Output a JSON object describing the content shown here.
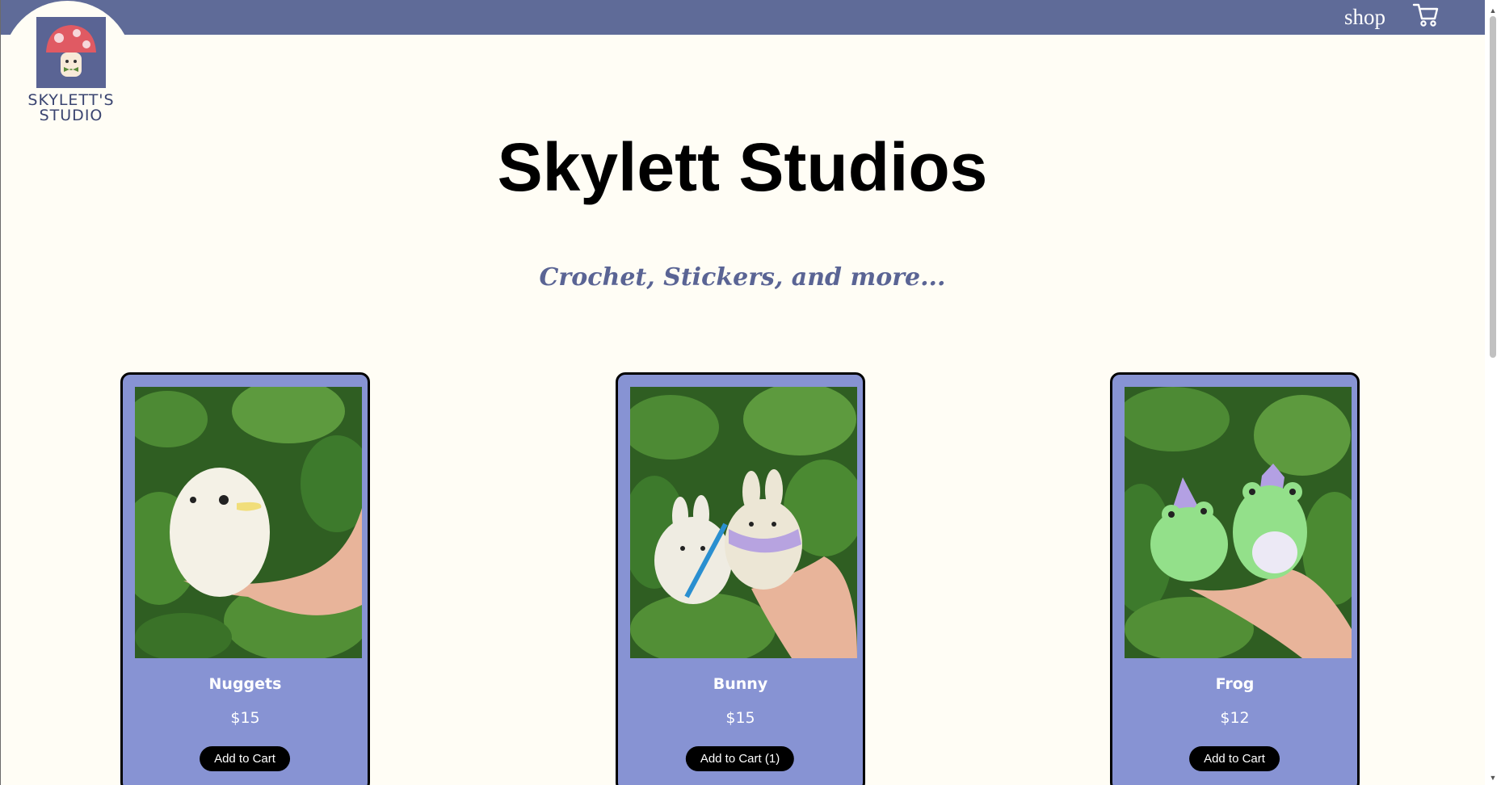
{
  "header": {
    "logo_text_line1": "SKYLETT'S",
    "logo_text_line2": "STUDIO",
    "nav_shop": "shop",
    "cart_icon": "shopping-cart-icon",
    "bar_color": "#5f6b98"
  },
  "hero": {
    "title": "Skylett Studios",
    "subtitle": "Crochet, Stickers, and more..."
  },
  "products": [
    {
      "name": "Nuggets",
      "price": "$15",
      "button": "Add to Cart",
      "photo": "crochet white chick plush held in hand against green leaves"
    },
    {
      "name": "Bunny",
      "price": "$15",
      "button": "Add to Cart (1)",
      "photo": "two crochet bunny plushes with scarves held in hand against green leaves"
    },
    {
      "name": "Frog",
      "price": "$12",
      "button": "Add to Cart",
      "photo": "two green crochet frog plushes with purple hats held in hand against green leaves"
    }
  ],
  "colors": {
    "page_background": "#fffdf5",
    "card_background": "#8793d3",
    "subtitle": "#5a6494",
    "button": "#000000"
  }
}
